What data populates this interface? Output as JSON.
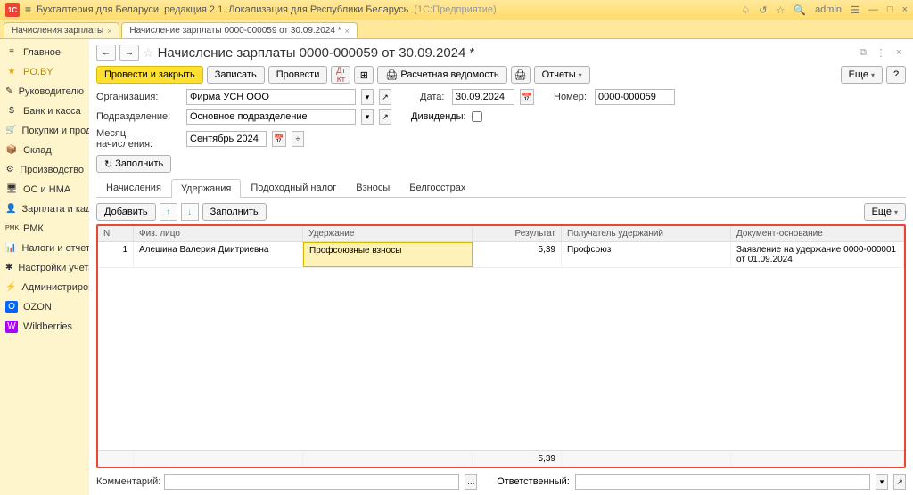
{
  "titlebar": {
    "app_title": "Бухгалтерия для Беларуси, редакция 2.1. Локализация для Республики Беларусь",
    "app_suffix": "(1С:Предприятие)",
    "user": "admin"
  },
  "tabs": [
    {
      "label": "Начисления зарплаты"
    },
    {
      "label": "Начисление зарплаты 0000-000059 от 30.09.2024 *"
    }
  ],
  "sidebar": [
    {
      "icon": "≡",
      "label": "Главное"
    },
    {
      "icon": "★",
      "label": "PO.BY"
    },
    {
      "icon": "✎",
      "label": "Руководителю"
    },
    {
      "icon": "$",
      "label": "Банк и касса"
    },
    {
      "icon": "🛒",
      "label": "Покупки и продажи"
    },
    {
      "icon": "📦",
      "label": "Склад"
    },
    {
      "icon": "⚙",
      "label": "Производство"
    },
    {
      "icon": "🖥",
      "label": "ОС и НМА"
    },
    {
      "icon": "👤",
      "label": "Зарплата и кадры"
    },
    {
      "icon": "PMK",
      "label": "РМК"
    },
    {
      "icon": "📊",
      "label": "Налоги и отчетность"
    },
    {
      "icon": "✱",
      "label": "Настройки учета"
    },
    {
      "icon": "⚡",
      "label": "Администрирование"
    },
    {
      "icon": "O",
      "label": "OZON"
    },
    {
      "icon": "W",
      "label": "Wildberries"
    }
  ],
  "doc": {
    "title": "Начисление зарплаты 0000-000059 от 30.09.2024 *"
  },
  "toolbar": {
    "post_close": "Провести и закрыть",
    "write": "Записать",
    "post": "Провести",
    "payroll": "Расчетная ведомость",
    "reports": "Отчеты",
    "more": "Еще",
    "help": "?"
  },
  "form": {
    "org_label": "Организация:",
    "org_value": "Фирма УСН ООО",
    "date_label": "Дата:",
    "date_value": "30.09.2024",
    "num_label": "Номер:",
    "num_value": "0000-000059",
    "div_label": "Подразделение:",
    "div_value": "Основное подразделение",
    "dividends_label": "Дивиденды:",
    "month_label": "Месяц начисления:",
    "month_value": "Сентябрь 2024"
  },
  "fill": "Заполнить",
  "innertabs": {
    "t1": "Начисления",
    "t2": "Удержания",
    "t3": "Подоходный налог",
    "t4": "Взносы",
    "t5": "Белгосстрах"
  },
  "tbltb": {
    "add": "Добавить",
    "fill": "Заполнить",
    "more": "Еще"
  },
  "table": {
    "head": {
      "n": "N",
      "person": "Физ. лицо",
      "ded": "Удержание",
      "res": "Результат",
      "rec": "Получатель удержаний",
      "doc": "Документ-основание"
    },
    "rows": [
      {
        "n": "1",
        "person": "Алешина Валерия Дмитриевна",
        "ded": "Профсоюзные взносы",
        "res": "5,39",
        "rec": "Профсоюз",
        "doc": "Заявление на удержание 0000-000001 от 01.09.2024"
      }
    ],
    "foot_res": "5,39"
  },
  "bottom": {
    "comment_label": "Комментарий:",
    "resp_label": "Ответственный:"
  }
}
